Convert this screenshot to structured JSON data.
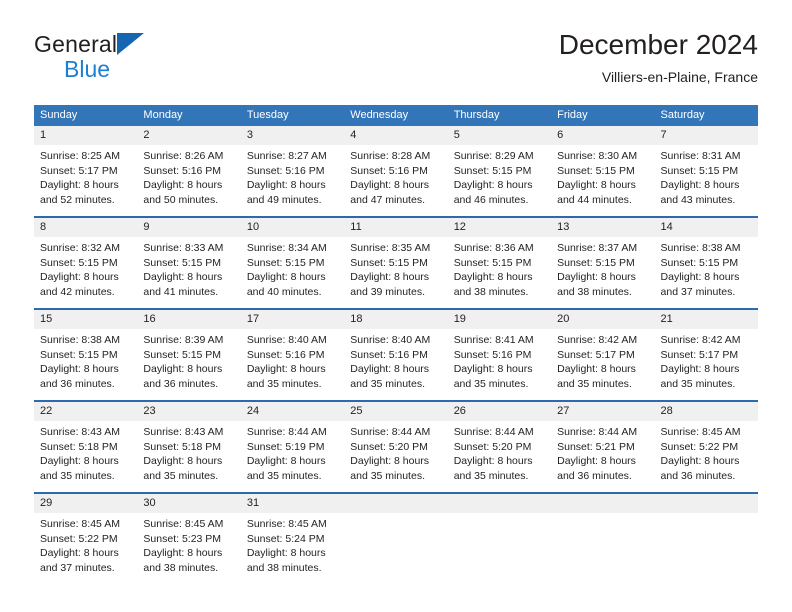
{
  "brand": {
    "name_part1": "General",
    "name_part2": "Blue",
    "triangle_icon": "triangle-icon",
    "colors": {
      "dark_text": "#231f20",
      "blue_text": "#1b7fd4",
      "triangle_blue": "#1565b0"
    }
  },
  "header": {
    "title": "December 2024",
    "subtitle": "Villiers-en-Plaine, France"
  },
  "calendar": {
    "colors": {
      "header_band": "#3275b9",
      "row_separator": "#2c6aad",
      "daynum_band": "#f0f0f0",
      "text": "#231f20"
    },
    "weekdays": [
      "Sunday",
      "Monday",
      "Tuesday",
      "Wednesday",
      "Thursday",
      "Friday",
      "Saturday"
    ],
    "weeks": [
      [
        {
          "day": "1",
          "sunrise": "Sunrise: 8:25 AM",
          "sunset": "Sunset: 5:17 PM",
          "daylight_line1": "Daylight: 8 hours",
          "daylight_line2": "and 52 minutes."
        },
        {
          "day": "2",
          "sunrise": "Sunrise: 8:26 AM",
          "sunset": "Sunset: 5:16 PM",
          "daylight_line1": "Daylight: 8 hours",
          "daylight_line2": "and 50 minutes."
        },
        {
          "day": "3",
          "sunrise": "Sunrise: 8:27 AM",
          "sunset": "Sunset: 5:16 PM",
          "daylight_line1": "Daylight: 8 hours",
          "daylight_line2": "and 49 minutes."
        },
        {
          "day": "4",
          "sunrise": "Sunrise: 8:28 AM",
          "sunset": "Sunset: 5:16 PM",
          "daylight_line1": "Daylight: 8 hours",
          "daylight_line2": "and 47 minutes."
        },
        {
          "day": "5",
          "sunrise": "Sunrise: 8:29 AM",
          "sunset": "Sunset: 5:15 PM",
          "daylight_line1": "Daylight: 8 hours",
          "daylight_line2": "and 46 minutes."
        },
        {
          "day": "6",
          "sunrise": "Sunrise: 8:30 AM",
          "sunset": "Sunset: 5:15 PM",
          "daylight_line1": "Daylight: 8 hours",
          "daylight_line2": "and 44 minutes."
        },
        {
          "day": "7",
          "sunrise": "Sunrise: 8:31 AM",
          "sunset": "Sunset: 5:15 PM",
          "daylight_line1": "Daylight: 8 hours",
          "daylight_line2": "and 43 minutes."
        }
      ],
      [
        {
          "day": "8",
          "sunrise": "Sunrise: 8:32 AM",
          "sunset": "Sunset: 5:15 PM",
          "daylight_line1": "Daylight: 8 hours",
          "daylight_line2": "and 42 minutes."
        },
        {
          "day": "9",
          "sunrise": "Sunrise: 8:33 AM",
          "sunset": "Sunset: 5:15 PM",
          "daylight_line1": "Daylight: 8 hours",
          "daylight_line2": "and 41 minutes."
        },
        {
          "day": "10",
          "sunrise": "Sunrise: 8:34 AM",
          "sunset": "Sunset: 5:15 PM",
          "daylight_line1": "Daylight: 8 hours",
          "daylight_line2": "and 40 minutes."
        },
        {
          "day": "11",
          "sunrise": "Sunrise: 8:35 AM",
          "sunset": "Sunset: 5:15 PM",
          "daylight_line1": "Daylight: 8 hours",
          "daylight_line2": "and 39 minutes."
        },
        {
          "day": "12",
          "sunrise": "Sunrise: 8:36 AM",
          "sunset": "Sunset: 5:15 PM",
          "daylight_line1": "Daylight: 8 hours",
          "daylight_line2": "and 38 minutes."
        },
        {
          "day": "13",
          "sunrise": "Sunrise: 8:37 AM",
          "sunset": "Sunset: 5:15 PM",
          "daylight_line1": "Daylight: 8 hours",
          "daylight_line2": "and 38 minutes."
        },
        {
          "day": "14",
          "sunrise": "Sunrise: 8:38 AM",
          "sunset": "Sunset: 5:15 PM",
          "daylight_line1": "Daylight: 8 hours",
          "daylight_line2": "and 37 minutes."
        }
      ],
      [
        {
          "day": "15",
          "sunrise": "Sunrise: 8:38 AM",
          "sunset": "Sunset: 5:15 PM",
          "daylight_line1": "Daylight: 8 hours",
          "daylight_line2": "and 36 minutes."
        },
        {
          "day": "16",
          "sunrise": "Sunrise: 8:39 AM",
          "sunset": "Sunset: 5:15 PM",
          "daylight_line1": "Daylight: 8 hours",
          "daylight_line2": "and 36 minutes."
        },
        {
          "day": "17",
          "sunrise": "Sunrise: 8:40 AM",
          "sunset": "Sunset: 5:16 PM",
          "daylight_line1": "Daylight: 8 hours",
          "daylight_line2": "and 35 minutes."
        },
        {
          "day": "18",
          "sunrise": "Sunrise: 8:40 AM",
          "sunset": "Sunset: 5:16 PM",
          "daylight_line1": "Daylight: 8 hours",
          "daylight_line2": "and 35 minutes."
        },
        {
          "day": "19",
          "sunrise": "Sunrise: 8:41 AM",
          "sunset": "Sunset: 5:16 PM",
          "daylight_line1": "Daylight: 8 hours",
          "daylight_line2": "and 35 minutes."
        },
        {
          "day": "20",
          "sunrise": "Sunrise: 8:42 AM",
          "sunset": "Sunset: 5:17 PM",
          "daylight_line1": "Daylight: 8 hours",
          "daylight_line2": "and 35 minutes."
        },
        {
          "day": "21",
          "sunrise": "Sunrise: 8:42 AM",
          "sunset": "Sunset: 5:17 PM",
          "daylight_line1": "Daylight: 8 hours",
          "daylight_line2": "and 35 minutes."
        }
      ],
      [
        {
          "day": "22",
          "sunrise": "Sunrise: 8:43 AM",
          "sunset": "Sunset: 5:18 PM",
          "daylight_line1": "Daylight: 8 hours",
          "daylight_line2": "and 35 minutes."
        },
        {
          "day": "23",
          "sunrise": "Sunrise: 8:43 AM",
          "sunset": "Sunset: 5:18 PM",
          "daylight_line1": "Daylight: 8 hours",
          "daylight_line2": "and 35 minutes."
        },
        {
          "day": "24",
          "sunrise": "Sunrise: 8:44 AM",
          "sunset": "Sunset: 5:19 PM",
          "daylight_line1": "Daylight: 8 hours",
          "daylight_line2": "and 35 minutes."
        },
        {
          "day": "25",
          "sunrise": "Sunrise: 8:44 AM",
          "sunset": "Sunset: 5:20 PM",
          "daylight_line1": "Daylight: 8 hours",
          "daylight_line2": "and 35 minutes."
        },
        {
          "day": "26",
          "sunrise": "Sunrise: 8:44 AM",
          "sunset": "Sunset: 5:20 PM",
          "daylight_line1": "Daylight: 8 hours",
          "daylight_line2": "and 35 minutes."
        },
        {
          "day": "27",
          "sunrise": "Sunrise: 8:44 AM",
          "sunset": "Sunset: 5:21 PM",
          "daylight_line1": "Daylight: 8 hours",
          "daylight_line2": "and 36 minutes."
        },
        {
          "day": "28",
          "sunrise": "Sunrise: 8:45 AM",
          "sunset": "Sunset: 5:22 PM",
          "daylight_line1": "Daylight: 8 hours",
          "daylight_line2": "and 36 minutes."
        }
      ],
      [
        {
          "day": "29",
          "sunrise": "Sunrise: 8:45 AM",
          "sunset": "Sunset: 5:22 PM",
          "daylight_line1": "Daylight: 8 hours",
          "daylight_line2": "and 37 minutes."
        },
        {
          "day": "30",
          "sunrise": "Sunrise: 8:45 AM",
          "sunset": "Sunset: 5:23 PM",
          "daylight_line1": "Daylight: 8 hours",
          "daylight_line2": "and 38 minutes."
        },
        {
          "day": "31",
          "sunrise": "Sunrise: 8:45 AM",
          "sunset": "Sunset: 5:24 PM",
          "daylight_line1": "Daylight: 8 hours",
          "daylight_line2": "and 38 minutes."
        },
        {
          "day": "",
          "sunrise": "",
          "sunset": "",
          "daylight_line1": "",
          "daylight_line2": ""
        },
        {
          "day": "",
          "sunrise": "",
          "sunset": "",
          "daylight_line1": "",
          "daylight_line2": ""
        },
        {
          "day": "",
          "sunrise": "",
          "sunset": "",
          "daylight_line1": "",
          "daylight_line2": ""
        },
        {
          "day": "",
          "sunrise": "",
          "sunset": "",
          "daylight_line1": "",
          "daylight_line2": ""
        }
      ]
    ]
  }
}
